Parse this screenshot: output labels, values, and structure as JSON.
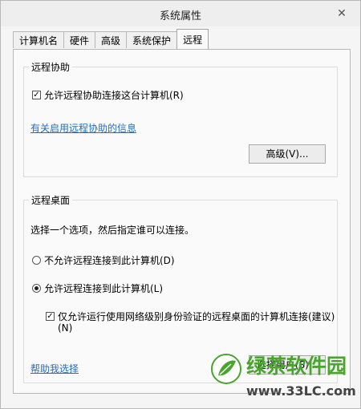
{
  "window": {
    "title": "系统属性"
  },
  "tabs": [
    {
      "label": "计算机名"
    },
    {
      "label": "硬件"
    },
    {
      "label": "高级"
    },
    {
      "label": "系统保护"
    },
    {
      "label": "远程",
      "active": true
    }
  ],
  "remote_assistance": {
    "label": "远程协助",
    "checkbox_label": "允许远程协助连接这台计算机(R)",
    "checked": true,
    "info_link": "有关启用远程协助的信息",
    "advanced_button": "高级(V)..."
  },
  "remote_desktop": {
    "label": "远程桌面",
    "description": "选择一个选项，然后指定谁可以连接。",
    "option_deny": "不允许远程连接到此计算机(D)",
    "option_allow": "允许远程连接到此计算机(L)",
    "selected": "allow",
    "nla_checkbox_line1": "仅允许运行使用网络级别身份验证的远程桌面的计算机连接(建议)",
    "nla_checkbox_line2": "(N)",
    "nla_checked": true,
    "help_link": "帮助我选择",
    "select_users_button": "选择用户(S)..."
  },
  "watermark": {
    "brand": "绿茶软件园",
    "url": "www.33LC.com",
    "brand_color": "#4aa52e"
  }
}
